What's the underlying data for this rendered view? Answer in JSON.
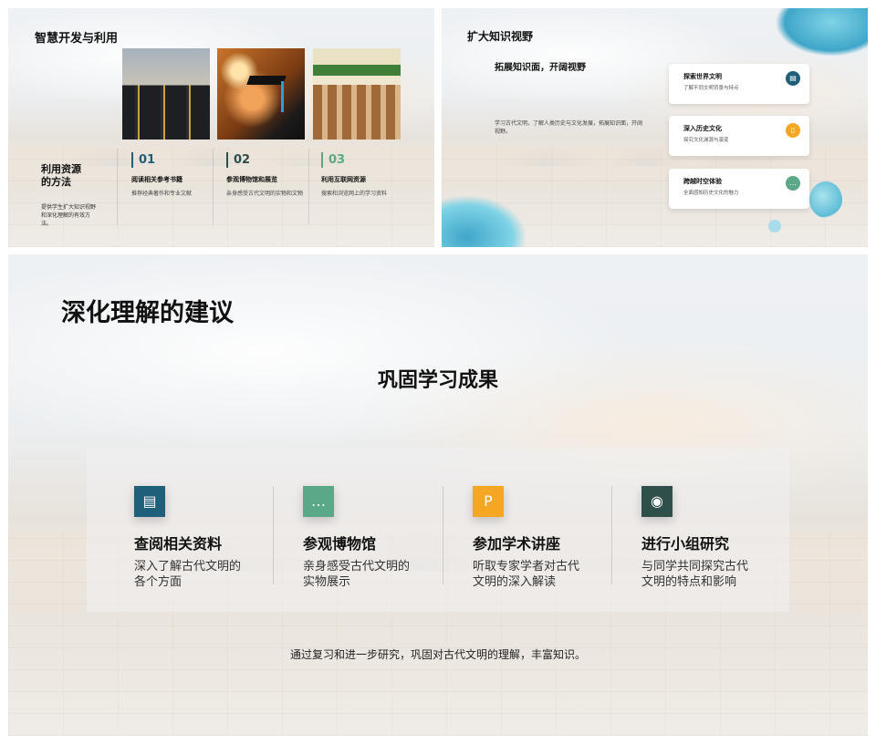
{
  "slide1": {
    "title": "智慧开发与利用",
    "side_title": "利用资源\n的方法",
    "side_desc": "提供学生扩大知识视野和深化理解的有效方法。",
    "columns": [
      {
        "num": "01",
        "heading": "阅读相关参考书籍",
        "desc": "推荐经典著作和专业文献",
        "color": "#1f5f7a"
      },
      {
        "num": "02",
        "heading": "参观博物馆和展览",
        "desc": "亲身感受古代文明的实物和文物",
        "color": "#2f4f4a"
      },
      {
        "num": "03",
        "heading": "利用互联网资源",
        "desc": "搜索和浏览网上的学习资料",
        "color": "#5aa886"
      }
    ]
  },
  "slide2": {
    "title": "扩大知识视野",
    "subtitle": "拓展知识面，开阔视野",
    "desc": "学习古代文明，了解人类历史与文化发展，拓展知识面，开阔视野。",
    "cards": [
      {
        "heading": "探索世界文明",
        "desc": "了解不同文明背景与特点",
        "icon": "briefcase-icon",
        "glyph": "▤",
        "color": "#1f5f7a"
      },
      {
        "heading": "深入历史文化",
        "desc": "探究文化渊源与演变",
        "icon": "document-icon",
        "glyph": "▯",
        "color": "#f5a623"
      },
      {
        "heading": "跨越时空体验",
        "desc": "全面感知历史文化的魅力",
        "icon": "chat-icon",
        "glyph": "…",
        "color": "#5aa886"
      }
    ]
  },
  "slide3": {
    "title": "深化理解的建议",
    "subtitle": "巩固学习成果",
    "items": [
      {
        "heading": "查阅相关资料",
        "desc": "深入了解古代文明的各个方面",
        "icon": "briefcase-icon",
        "glyph": "▤",
        "color": "#1f5f7a"
      },
      {
        "heading": "参观博物馆",
        "desc": "亲身感受古代文明的实物展示",
        "icon": "chat-icon",
        "glyph": "…",
        "color": "#5aa886"
      },
      {
        "heading": "参加学术讲座",
        "desc": "听取专家学者对古代文明的深入解读",
        "icon": "document-icon",
        "glyph": "P",
        "color": "#f5a623"
      },
      {
        "heading": "进行小组研究",
        "desc": "与同学共同探究古代文明的特点和影响",
        "icon": "location-icon",
        "glyph": "◉",
        "color": "#2f4f4a"
      }
    ],
    "footer": "通过复习和进一步研究，巩固对古代文明的理解，丰富知识。"
  }
}
